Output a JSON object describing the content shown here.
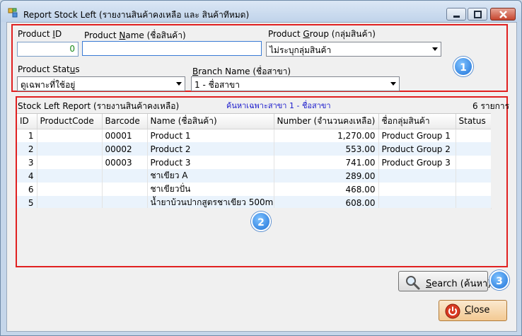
{
  "window": {
    "title": "Report Stock Left (รายงานสินค้าคงเหลือ และ สินค้าทีหมด)",
    "controls": {
      "minimize_icon": "minimize-icon",
      "maximize_icon": "maximize-icon",
      "close_icon": "close-icon"
    }
  },
  "filters": {
    "product_id": {
      "label_pre": "Product ",
      "label_ul": "I",
      "label_post": "D",
      "value": "0"
    },
    "product_name": {
      "label_pre": "Product ",
      "label_ul": "N",
      "label_post": "ame (ชื่อสินค้า)",
      "value": ""
    },
    "product_group": {
      "label_pre": "Product ",
      "label_ul": "G",
      "label_post": "roup (กลุ่มสินค้า)",
      "value": "ไม่ระบุกลุ่มสินค้า"
    },
    "product_status": {
      "label_pre": "Product Stat",
      "label_ul": "u",
      "label_post": "s",
      "value": "ดูเฉพาะที่ใช้อยู่"
    },
    "branch_name": {
      "label_ul": "B",
      "label_post": "ranch Name (ชื่อสาขา)",
      "value": "1 - ชื่อสาขา"
    }
  },
  "report": {
    "title": "Stock Left Report (รายงานสินค้าคงเหลือ)",
    "branch_note": "ค้นหาเฉพาะสาขา 1 - ชื่อสาขา",
    "count": "6 รายการ",
    "columns": [
      "ID",
      "ProductCode",
      "Barcode",
      "Name  (ชื่อสินค้า)",
      "Number  (จำนวนคงเหลือ)",
      "ชื่อกลุ่มสินค้า",
      "Status"
    ],
    "rows": [
      {
        "id": "1",
        "code": "",
        "barcode": "00001",
        "name": "Product 1",
        "number": "1,270.00",
        "group": "Product Group 1",
        "status": ""
      },
      {
        "id": "2",
        "code": "",
        "barcode": "00002",
        "name": "Product 2",
        "number": "553.00",
        "group": "Product Group 2",
        "status": ""
      },
      {
        "id": "3",
        "code": "",
        "barcode": "00003",
        "name": "Product 3",
        "number": "741.00",
        "group": "Product Group 3",
        "status": ""
      },
      {
        "id": "4",
        "code": "",
        "barcode": "",
        "name": "ชาเขียว A",
        "number": "289.00",
        "group": "",
        "status": ""
      },
      {
        "id": "6",
        "code": "",
        "barcode": "",
        "name": "ชาเขียวปั่น",
        "number": "468.00",
        "group": "",
        "status": ""
      },
      {
        "id": "5",
        "code": "",
        "barcode": "",
        "name": "น้ำยาบ้วนปากสูตรชาเขียว  500ml",
        "number": "608.00",
        "group": "",
        "status": ""
      }
    ]
  },
  "buttons": {
    "search": {
      "ul": "S",
      "rest": "earch (ค้นหา)",
      "icon": "magnifier-icon"
    },
    "close": {
      "ul": "C",
      "rest": "lose",
      "icon": "power-icon"
    }
  },
  "badges": [
    "1",
    "2",
    "3"
  ],
  "colors": {
    "highlight_border": "#e02020",
    "badge_blue": "#1f73d8",
    "alt_row": "#eaf3fc",
    "note_text": "#1a1acc",
    "id_value": "#1a8a1a"
  }
}
